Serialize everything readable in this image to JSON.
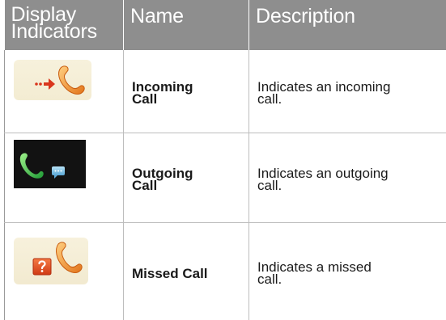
{
  "table": {
    "headers": [
      {
        "lines": [
          "Display",
          "Indicators"
        ]
      },
      {
        "lines": [
          "Name"
        ]
      },
      {
        "lines": [
          "Description"
        ]
      }
    ],
    "rows": [
      {
        "icon": "incoming-call-icon",
        "name_lines": [
          "Incoming",
          "Call"
        ],
        "desc_lines": [
          "Indicates an incoming",
          "call."
        ]
      },
      {
        "icon": "outgoing-call-icon",
        "name_lines": [
          "Outgoing",
          "Call"
        ],
        "desc_lines": [
          "Indicates an outgoing",
          "call."
        ]
      },
      {
        "icon": "missed-call-icon",
        "name_lines": [
          "Missed Call"
        ],
        "desc_lines": [
          "Indicates a missed",
          "call."
        ]
      }
    ]
  },
  "colors": {
    "header_bg": "#8e8e8e",
    "header_text": "#ffffff",
    "handset_orange": "#f28c28",
    "arrow_red": "#d9361c",
    "handset_green": "#39b54a",
    "chat_blue": "#7ec3e8"
  }
}
